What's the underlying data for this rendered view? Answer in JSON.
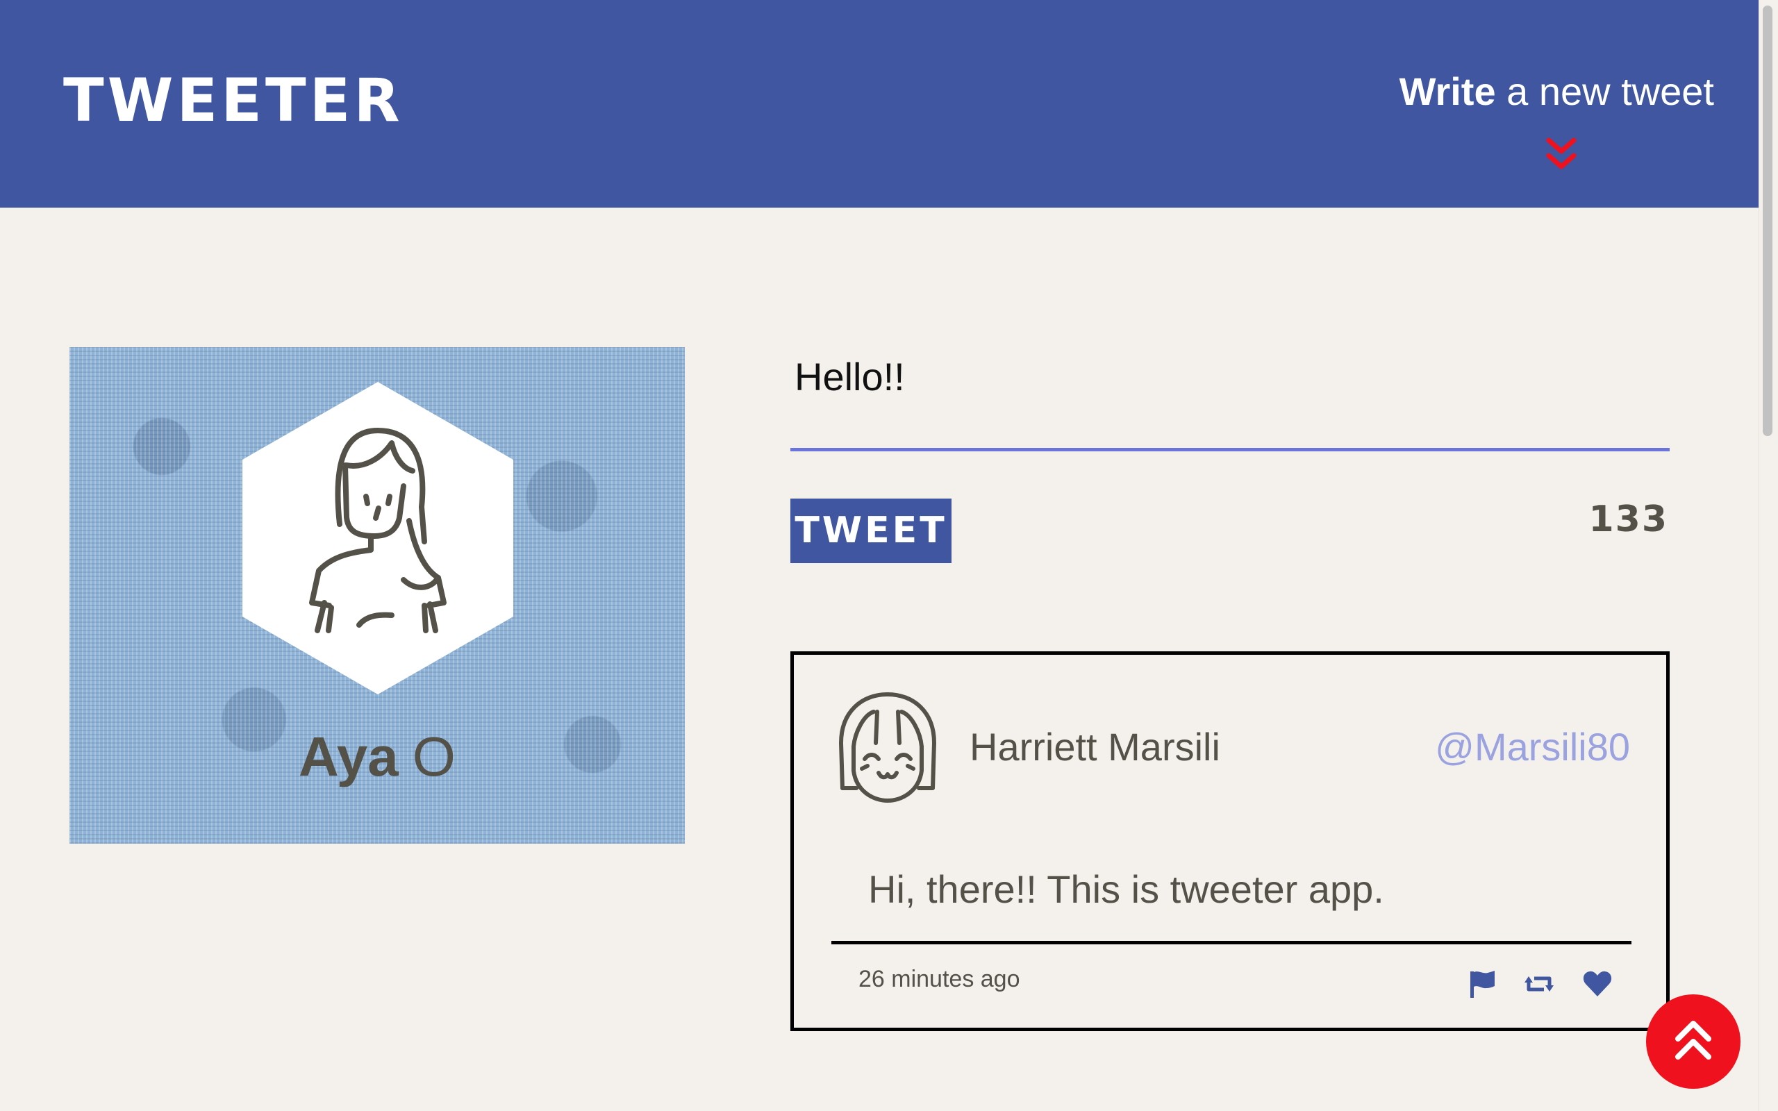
{
  "nav": {
    "brand": "TWEETER",
    "write_bold": "Write",
    "write_rest": " a new tweet",
    "chevron_icon": "double-chevron-down-icon",
    "chevron_color": "#f0111e",
    "background": "#4056a1"
  },
  "profile": {
    "name": "Aya",
    "name_suffix": "O",
    "avatar_icon": "girl-avatar-icon"
  },
  "compose": {
    "text": "Hello!!",
    "button_label": "TWEET",
    "counter": "133",
    "underline_color": "#6b74d8"
  },
  "tweets": [
    {
      "avatar_icon": "smiling-girl-avatar-icon",
      "full_name": "Harriett Marsili",
      "handle": "@Marsili80",
      "content": "Hi, there!! This is tweeter app.",
      "time": "26 minutes ago",
      "actions": [
        "flag-icon",
        "retweet-icon",
        "heart-icon"
      ]
    }
  ],
  "scroll_top": {
    "icon": "double-chevron-up-icon",
    "color": "#f0111e"
  }
}
